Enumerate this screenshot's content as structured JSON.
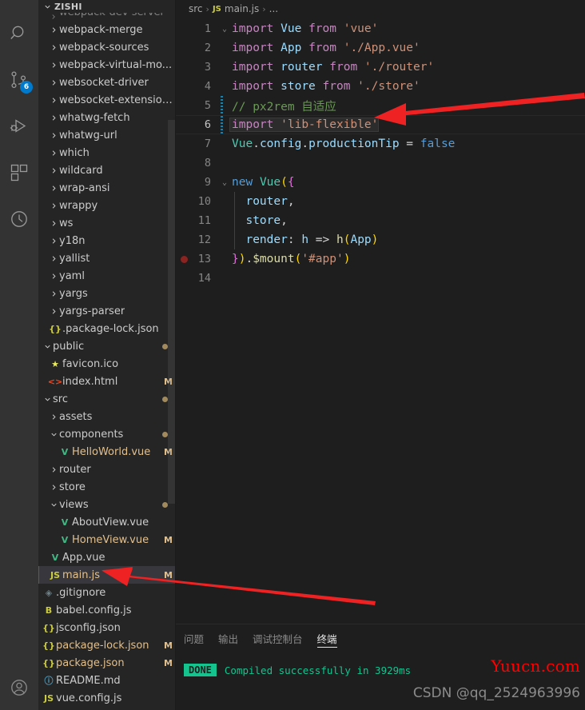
{
  "activitybar": {
    "items": [
      {
        "name": "search-icon",
        "label": "Search"
      },
      {
        "name": "source-control-icon",
        "label": "Source Control",
        "badge": "6"
      },
      {
        "name": "run-debug-icon",
        "label": "Run and Debug"
      },
      {
        "name": "extensions-icon",
        "label": "Extensions"
      },
      {
        "name": "timeline-icon",
        "label": "Timeline"
      }
    ],
    "account_icon": "account-icon"
  },
  "sidebar": {
    "title": "ZISHI",
    "partial_top_row": "webpack-dev-server",
    "tree": [
      {
        "label": "webpack-merge",
        "type": "folder",
        "indent": 1,
        "expanded": false
      },
      {
        "label": "webpack-sources",
        "type": "folder",
        "indent": 1,
        "expanded": false
      },
      {
        "label": "webpack-virtual-mo...",
        "type": "folder",
        "indent": 1,
        "expanded": false
      },
      {
        "label": "websocket-driver",
        "type": "folder",
        "indent": 1,
        "expanded": false
      },
      {
        "label": "websocket-extensions",
        "type": "folder",
        "indent": 1,
        "expanded": false
      },
      {
        "label": "whatwg-fetch",
        "type": "folder",
        "indent": 1,
        "expanded": false
      },
      {
        "label": "whatwg-url",
        "type": "folder",
        "indent": 1,
        "expanded": false
      },
      {
        "label": "which",
        "type": "folder",
        "indent": 1,
        "expanded": false
      },
      {
        "label": "wildcard",
        "type": "folder",
        "indent": 1,
        "expanded": false
      },
      {
        "label": "wrap-ansi",
        "type": "folder",
        "indent": 1,
        "expanded": false
      },
      {
        "label": "wrappy",
        "type": "folder",
        "indent": 1,
        "expanded": false
      },
      {
        "label": "ws",
        "type": "folder",
        "indent": 1,
        "expanded": false
      },
      {
        "label": "y18n",
        "type": "folder",
        "indent": 1,
        "expanded": false
      },
      {
        "label": "yallist",
        "type": "folder",
        "indent": 1,
        "expanded": false
      },
      {
        "label": "yaml",
        "type": "folder",
        "indent": 1,
        "expanded": false
      },
      {
        "label": "yargs",
        "type": "folder",
        "indent": 1,
        "expanded": false
      },
      {
        "label": "yargs-parser",
        "type": "folder",
        "indent": 1,
        "expanded": false
      },
      {
        "label": ".package-lock.json",
        "type": "json",
        "indent": 1,
        "icon": "{}",
        "icon_color": "#cbcb41"
      },
      {
        "label": "public",
        "type": "folder",
        "indent": 0,
        "expanded": true,
        "dot": true
      },
      {
        "label": "favicon.ico",
        "type": "file",
        "indent": 1,
        "icon": "★",
        "icon_color": "#e9e95c"
      },
      {
        "label": "index.html",
        "type": "file",
        "indent": 1,
        "icon": "<>",
        "icon_color": "#e44d26",
        "mark": "M"
      },
      {
        "label": "src",
        "type": "folder",
        "indent": 0,
        "expanded": true,
        "dot": true
      },
      {
        "label": "assets",
        "type": "folder",
        "indent": 1,
        "expanded": false
      },
      {
        "label": "components",
        "type": "folder",
        "indent": 1,
        "expanded": true,
        "dot": true
      },
      {
        "label": "HelloWorld.vue",
        "type": "vue",
        "indent": 2,
        "icon": "V",
        "icon_color": "#41b883",
        "mark": "M",
        "label_color": "#e2c08d"
      },
      {
        "label": "router",
        "type": "folder",
        "indent": 1,
        "expanded": false
      },
      {
        "label": "store",
        "type": "folder",
        "indent": 1,
        "expanded": false
      },
      {
        "label": "views",
        "type": "folder",
        "indent": 1,
        "expanded": true,
        "dot": true
      },
      {
        "label": "AboutView.vue",
        "type": "vue",
        "indent": 2,
        "icon": "V",
        "icon_color": "#41b883"
      },
      {
        "label": "HomeView.vue",
        "type": "vue",
        "indent": 2,
        "icon": "V",
        "icon_color": "#41b883",
        "mark": "M",
        "label_color": "#e2c08d"
      },
      {
        "label": "App.vue",
        "type": "vue",
        "indent": 1,
        "icon": "V",
        "icon_color": "#41b883"
      },
      {
        "label": "main.js",
        "type": "js",
        "indent": 1,
        "icon": "JS",
        "icon_color": "#cbcb41",
        "mark": "M",
        "selected": true,
        "label_color": "#e2c08d"
      },
      {
        "label": ".gitignore",
        "type": "file",
        "indent": 0,
        "icon": "◈",
        "icon_color": "#6d8086"
      },
      {
        "label": "babel.config.js",
        "type": "file",
        "indent": 0,
        "icon": "B",
        "icon_color": "#cbcb41"
      },
      {
        "label": "jsconfig.json",
        "type": "json",
        "indent": 0,
        "icon": "{}",
        "icon_color": "#cbcb41"
      },
      {
        "label": "package-lock.json",
        "type": "json",
        "indent": 0,
        "icon": "{}",
        "icon_color": "#cbcb41",
        "mark": "M",
        "label_color": "#e2c08d"
      },
      {
        "label": "package.json",
        "type": "json",
        "indent": 0,
        "icon": "{}",
        "icon_color": "#cbcb41",
        "mark": "M",
        "label_color": "#e2c08d"
      },
      {
        "label": "README.md",
        "type": "file",
        "indent": 0,
        "icon": "ⓘ",
        "icon_color": "#519aba"
      },
      {
        "label": "vue.config.js",
        "type": "js",
        "indent": 0,
        "icon": "JS",
        "icon_color": "#cbcb41"
      }
    ]
  },
  "breadcrumb": {
    "folder": "src",
    "file": "main.js",
    "file_icon": "JS",
    "more": "...",
    "separator": "›"
  },
  "editor": {
    "file": "main.js",
    "lines": [
      {
        "n": "1",
        "fold": "⌄",
        "tokens": [
          {
            "t": "import",
            "c": "t-kw"
          },
          {
            "t": " ",
            "c": "t-plain"
          },
          {
            "t": "Vue",
            "c": "t-var"
          },
          {
            "t": " ",
            "c": "t-plain"
          },
          {
            "t": "from",
            "c": "t-kw"
          },
          {
            "t": " ",
            "c": "t-plain"
          },
          {
            "t": "'vue'",
            "c": "t-str"
          }
        ]
      },
      {
        "n": "2",
        "tokens": [
          {
            "t": "import",
            "c": "t-kw"
          },
          {
            "t": " ",
            "c": "t-plain"
          },
          {
            "t": "App",
            "c": "t-var"
          },
          {
            "t": " ",
            "c": "t-plain"
          },
          {
            "t": "from",
            "c": "t-kw"
          },
          {
            "t": " ",
            "c": "t-plain"
          },
          {
            "t": "'./App.vue'",
            "c": "t-str"
          }
        ]
      },
      {
        "n": "3",
        "tokens": [
          {
            "t": "import",
            "c": "t-kw"
          },
          {
            "t": " ",
            "c": "t-plain"
          },
          {
            "t": "router",
            "c": "t-var"
          },
          {
            "t": " ",
            "c": "t-plain"
          },
          {
            "t": "from",
            "c": "t-kw"
          },
          {
            "t": " ",
            "c": "t-plain"
          },
          {
            "t": "'./router'",
            "c": "t-str"
          }
        ]
      },
      {
        "n": "4",
        "tokens": [
          {
            "t": "import",
            "c": "t-kw"
          },
          {
            "t": " ",
            "c": "t-plain"
          },
          {
            "t": "store",
            "c": "t-var"
          },
          {
            "t": " ",
            "c": "t-plain"
          },
          {
            "t": "from",
            "c": "t-kw"
          },
          {
            "t": " ",
            "c": "t-plain"
          },
          {
            "t": "'./store'",
            "c": "t-str"
          }
        ]
      },
      {
        "n": "5",
        "diff": true,
        "tokens": [
          {
            "t": "// px2rem 自适应",
            "c": "t-cmt"
          }
        ]
      },
      {
        "n": "6",
        "diff": true,
        "current": true,
        "tokens": [
          {
            "t": "import",
            "c": "t-kw"
          },
          {
            "t": " ",
            "c": "t-plain"
          },
          {
            "t": "'lib-flexible'",
            "c": "t-str"
          }
        ]
      },
      {
        "n": "7",
        "tokens": [
          {
            "t": "Vue",
            "c": "t-fn"
          },
          {
            "t": ".",
            "c": "t-plain"
          },
          {
            "t": "config",
            "c": "t-prop"
          },
          {
            "t": ".",
            "c": "t-plain"
          },
          {
            "t": "productionTip",
            "c": "t-prop"
          },
          {
            "t": " = ",
            "c": "t-op"
          },
          {
            "t": "false",
            "c": "t-bool"
          }
        ]
      },
      {
        "n": "8",
        "tokens": []
      },
      {
        "n": "9",
        "fold": "⌄",
        "tokens": [
          {
            "t": "new",
            "c": "t-ctrl"
          },
          {
            "t": " ",
            "c": "t-plain"
          },
          {
            "t": "Vue",
            "c": "t-fn"
          },
          {
            "t": "(",
            "c": "t-p1"
          },
          {
            "t": "{",
            "c": "t-p2"
          }
        ]
      },
      {
        "n": "10",
        "indent_guide": true,
        "tokens": [
          {
            "t": "  ",
            "c": "t-plain"
          },
          {
            "t": "router",
            "c": "t-var"
          },
          {
            "t": ",",
            "c": "t-plain"
          }
        ]
      },
      {
        "n": "11",
        "indent_guide": true,
        "tokens": [
          {
            "t": "  ",
            "c": "t-plain"
          },
          {
            "t": "store",
            "c": "t-var"
          },
          {
            "t": ",",
            "c": "t-plain"
          }
        ]
      },
      {
        "n": "12",
        "indent_guide": true,
        "tokens": [
          {
            "t": "  ",
            "c": "t-plain"
          },
          {
            "t": "render",
            "c": "t-var"
          },
          {
            "t": ": ",
            "c": "t-plain"
          },
          {
            "t": "h",
            "c": "t-var"
          },
          {
            "t": " ",
            "c": "t-plain"
          },
          {
            "t": "=>",
            "c": "t-op"
          },
          {
            "t": " ",
            "c": "t-plain"
          },
          {
            "t": "h",
            "c": "t-mth"
          },
          {
            "t": "(",
            "c": "t-p1"
          },
          {
            "t": "App",
            "c": "t-var"
          },
          {
            "t": ")",
            "c": "t-p1"
          }
        ]
      },
      {
        "n": "13",
        "breakpoint": true,
        "tokens": [
          {
            "t": "}",
            "c": "t-p2"
          },
          {
            "t": ")",
            "c": "t-p1"
          },
          {
            "t": ".",
            "c": "t-plain"
          },
          {
            "t": "$mount",
            "c": "t-mth"
          },
          {
            "t": "(",
            "c": "t-p1"
          },
          {
            "t": "'#app'",
            "c": "t-str"
          },
          {
            "t": ")",
            "c": "t-p1"
          }
        ]
      },
      {
        "n": "14",
        "tokens": []
      }
    ]
  },
  "panel": {
    "tabs": [
      {
        "label": "问题",
        "name": "tab-problems",
        "active": false
      },
      {
        "label": "输出",
        "name": "tab-output",
        "active": false
      },
      {
        "label": "调试控制台",
        "name": "tab-debug-console",
        "active": false
      },
      {
        "label": "终端",
        "name": "tab-terminal",
        "active": true
      }
    ],
    "terminal": {
      "badge": "DONE",
      "message": "Compiled successfully in 3929ms"
    }
  },
  "watermarks": {
    "red": "Yuucn.com",
    "grey": "CSDN @qq_2524963996"
  },
  "colors": {
    "accent": "#007acc",
    "editor_bg": "#1e1e1e",
    "sidebar_bg": "#252526",
    "activitybar_bg": "#333333",
    "selection_bg": "#37373d",
    "modified_mark": "#e2c08d",
    "success": "#14c38e",
    "arrow_red": "#ee2222"
  }
}
